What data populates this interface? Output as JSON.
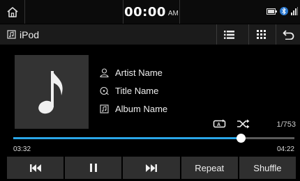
{
  "statusbar": {
    "time": "00:00",
    "ampm": "AM",
    "icons": [
      "home-icon",
      "battery-icon",
      "bluetooth-icon",
      "signal-icon"
    ]
  },
  "toolbar": {
    "source_label": "iPod",
    "icons": [
      "ipod-source-icon",
      "list-icon",
      "grid-menu-icon",
      "back-icon"
    ]
  },
  "track": {
    "artist": "Artist Name",
    "title": "Title Name",
    "album": "Album Name",
    "count": "1/753",
    "art_icon": "music-note-icon"
  },
  "progress": {
    "elapsed": "03:32",
    "total": "04:22",
    "fraction": 0.808
  },
  "controls": {
    "prev_icon": "skip-previous-icon",
    "pause_icon": "pause-icon",
    "next_icon": "skip-next-icon",
    "repeat_label": "Repeat",
    "shuffle_label": "Shuffle"
  },
  "colors": {
    "accent": "#2aa6e8",
    "background": "#000000",
    "toolbar": "#1b1b1b",
    "button": "#2f2f2f"
  }
}
